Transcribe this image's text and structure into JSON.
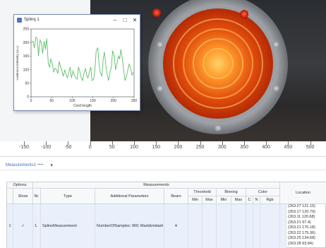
{
  "plot_window": {
    "title": "Splinq 1",
    "minimize": "–",
    "maximize": "□",
    "close": "✕"
  },
  "chart_data": {
    "type": "line",
    "xlabel": "Cord length",
    "ylabel": "Luminous intensity (a.u.)",
    "xlim": [
      0,
      250
    ],
    "ylim": [
      0,
      250
    ],
    "xticks": [
      "0",
      "50",
      "100",
      "150",
      "200",
      "250"
    ],
    "yticks": [
      "0",
      "50",
      "100",
      "150",
      "200",
      "250"
    ],
    "grid": false,
    "series_color": "#5cbf6a",
    "x": [
      0,
      5,
      8,
      12,
      15,
      18,
      22,
      25,
      28,
      32,
      35,
      38,
      42,
      45,
      48,
      52,
      55,
      58,
      62,
      65,
      68,
      72,
      75,
      78,
      82,
      85,
      88,
      92,
      95,
      98,
      102,
      105,
      108,
      112,
      115,
      118,
      122,
      125,
      128,
      132,
      135,
      138,
      142,
      145,
      148,
      152,
      155,
      158,
      162,
      165,
      168,
      172,
      175,
      178,
      182,
      185,
      188,
      192,
      195,
      198,
      202,
      205,
      208,
      212,
      215,
      218,
      222,
      225,
      228,
      232,
      235,
      238,
      242,
      245,
      248
    ],
    "y": [
      200,
      205,
      180,
      220,
      215,
      150,
      210,
      200,
      160,
      205,
      175,
      215,
      120,
      110,
      140,
      118,
      90,
      105,
      100,
      85,
      130,
      110,
      95,
      75,
      100,
      82,
      70,
      90,
      110,
      70,
      95,
      80,
      72,
      65,
      110,
      95,
      70,
      60,
      85,
      105,
      80,
      70,
      95,
      110,
      60,
      65,
      100,
      170,
      180,
      120,
      90,
      75,
      140,
      165,
      110,
      80,
      60,
      95,
      110,
      170,
      150,
      100,
      120,
      150,
      140,
      175,
      135,
      95,
      60,
      80,
      100,
      120,
      105,
      80,
      90
    ]
  },
  "ruler": {
    "labels": [
      "-150",
      "-100",
      "-50",
      "0",
      "50",
      "100",
      "150",
      "200",
      "250",
      "300",
      "350",
      "400",
      "450",
      "500"
    ]
  },
  "tabs": {
    "active": "Measurements1",
    "decor": "••••",
    "add": "▾"
  },
  "table": {
    "group_options": "Options",
    "group_measurements": "Measurements",
    "col_index": "",
    "col_show": "Show",
    "col_no": "Nr.",
    "col_type": "Type",
    "col_params": "Additional Parameters",
    "col_beam": "Beam",
    "group_threshold": "Threshold",
    "group_binning": "Binning",
    "group_color": "Color",
    "thr_min": "Min",
    "thr_max": "Max",
    "bin_min": "Min",
    "bin_max": "Max",
    "col_c": "C",
    "col_n": "N",
    "col_rgb": "Rgb",
    "col_location": "Location",
    "row": {
      "index": "1",
      "show": "✓",
      "nr": "1.",
      "type": "SplineMeasurement",
      "params": "NumberOfSamples: 960; Mark&mdash;",
      "beam": "▾",
      "locations": [
        "(263.27 121.15)",
        "(263.17 120.79)",
        "(263.11 120.68)",
        "(263.21 97.4)",
        "(263.21 176.18)",
        "(263.22 175.36)",
        "(263.25 134.68)",
        "(263.28 93.84)",
        "(263.25 106.61)"
      ]
    }
  }
}
